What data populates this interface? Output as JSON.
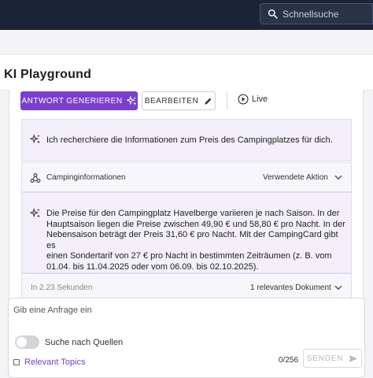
{
  "header": {
    "search_label": "Schnellsuche",
    "icons": [
      "search-icon"
    ]
  },
  "page": {
    "title": "KI Playground"
  },
  "toolbar": {
    "generate_label": "ANTWORT GENERIEREN",
    "edit_label": "BEARBEITEN",
    "live_label": "Live",
    "icons": [
      "sparkle-icon",
      "pencil-icon",
      "play-icon"
    ]
  },
  "conversation": {
    "status_message": "Ich recherchiere die Informationen zum Preis des Campingplatzes für dich.",
    "action": {
      "name": "Campinginformationen",
      "toggle_label": "Verwendete Aktion"
    },
    "answer_lines": [
      "Die Preise für den Campingplatz Havelberge variieren je nach Saison. In der",
      "Hauptsaison liegen die Preise zwischen 49,90 € und 58,80 € pro Nacht. In der",
      "Nebensaison beträgt der Preis 31,60 € pro Nacht. Mit der CampingCard gibt es",
      "einen Sondertarif von 27 € pro Nacht in bestimmten Zeiträumen (z. B. vom",
      "01.04. bis 11.04.2025 oder vom 06.09. bis 02.10.2025)."
    ],
    "footer": {
      "duration": "In 2.23 Sekunden",
      "documents": "1 relevantes Dokument"
    }
  },
  "composer": {
    "placeholder": "Gib eine Anfrage ein",
    "toggle_label": "Suche nach Quellen",
    "toggle_on": false,
    "topics_label": "Relevant Topics",
    "topics_checked": false,
    "counter": "0/256",
    "send_label": "SENDEN"
  },
  "colors": {
    "topbar": "#1b2336",
    "accent": "#7a3fcf",
    "card_bg": "#f3f0fb"
  }
}
